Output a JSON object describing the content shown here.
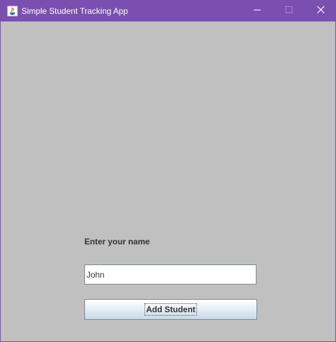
{
  "window": {
    "title": "Simple Student Tracking App",
    "colors": {
      "titlebar": "#7a4fb0",
      "content_bg": "#c0c0c0"
    },
    "icons": [
      "java-app-icon",
      "minimize-icon",
      "maximize-icon",
      "close-icon"
    ]
  },
  "form": {
    "name_label": "Enter your name",
    "name_value": "John",
    "submit_label": "Add Student"
  }
}
